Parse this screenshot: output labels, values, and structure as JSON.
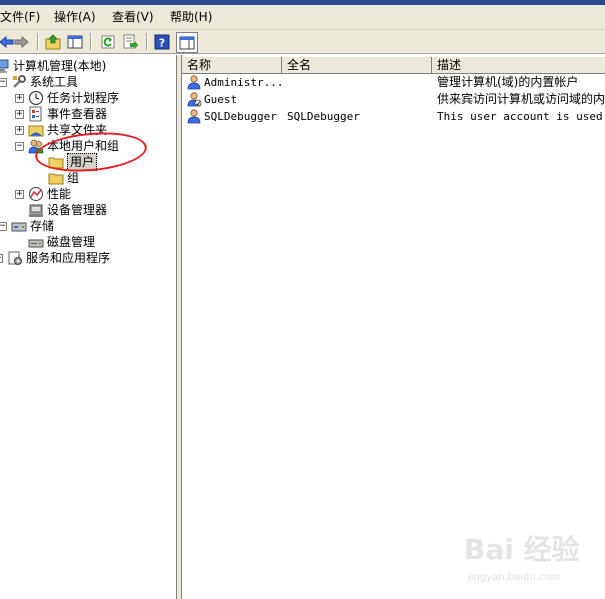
{
  "menu": [
    {
      "label": "文件(F)"
    },
    {
      "label": "操作(A)"
    },
    {
      "label": "查看(V)"
    },
    {
      "label": "帮助(H)"
    }
  ],
  "toolbar": {
    "buttons": [
      "back-icon",
      "forward-icon",
      "up-folder-icon",
      "show-hide-console-tree-icon",
      "refresh-icon",
      "export-list-icon",
      "help-icon",
      "action-pane-icon"
    ]
  },
  "tree": {
    "root": "计算机管理(本地)",
    "system_tools": "系统工具",
    "task_scheduler": "任务计划程序",
    "event_viewer": "事件查看器",
    "shared_folders": "共享文件夹",
    "local_users_groups": "本地用户和组",
    "users": "用户",
    "groups": "组",
    "performance": "性能",
    "device_manager": "设备管理器",
    "storage": "存储",
    "disk_management": "磁盘管理",
    "services_apps": "服务和应用程序"
  },
  "list": {
    "columns": [
      "名称",
      "全名",
      "描述"
    ],
    "rows": [
      {
        "name": "Administr...",
        "fullname": "",
        "description": "管理计算机(域)的内置帐户"
      },
      {
        "name": "Guest",
        "fullname": "",
        "description": "供来宾访问计算机或访问域的内"
      },
      {
        "name": "SQLDebugger",
        "fullname": "SQLDebugger",
        "description": "This user account is used by"
      }
    ]
  },
  "watermark": {
    "main": "Bai 经验",
    "sub": "jingyan.baidu.com"
  },
  "colors": {
    "annotation": "#e02020",
    "chrome": "#ece9d8"
  }
}
